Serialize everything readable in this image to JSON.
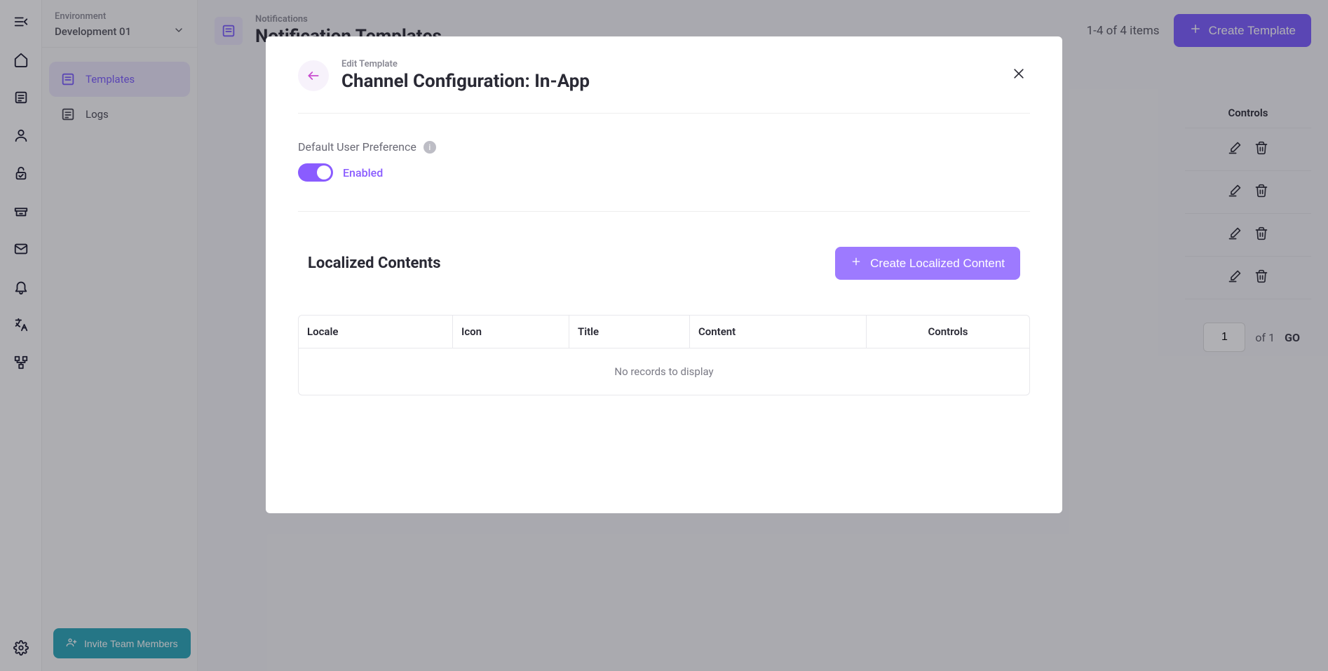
{
  "environment": {
    "label": "Environment",
    "name": "Development 01"
  },
  "sidebar": {
    "items": [
      {
        "label": "Templates"
      },
      {
        "label": "Logs"
      }
    ]
  },
  "page": {
    "breadcrumb": "Notifications",
    "title": "Notification Templates",
    "count_text": "1-4 of 4 items",
    "create_label": "Create Template",
    "controls_header": "Controls"
  },
  "pagination": {
    "page": "1",
    "of_label": "of 1",
    "go": "GO"
  },
  "invite": {
    "label": "Invite Team Members"
  },
  "modal": {
    "breadcrumb": "Edit Template",
    "title": "Channel Configuration: In-App",
    "pref_label": "Default User Preference",
    "toggle_state": "Enabled",
    "localized_title": "Localized Contents",
    "create_localized": "Create Localized Content",
    "columns": {
      "locale": "Locale",
      "icon": "Icon",
      "title": "Title",
      "content": "Content",
      "controls": "Controls"
    },
    "empty": "No records to display"
  }
}
